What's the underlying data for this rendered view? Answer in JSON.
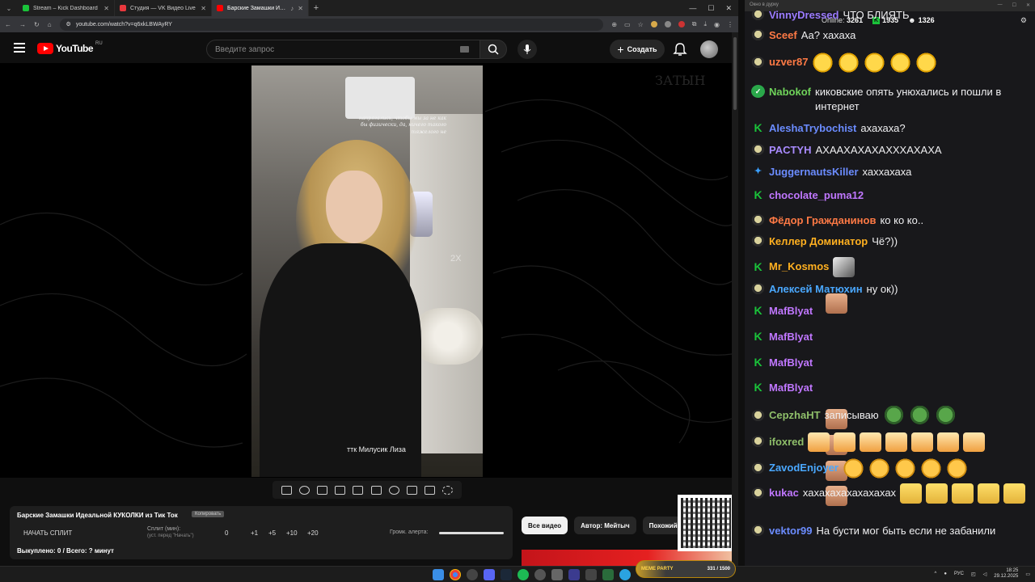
{
  "browser": {
    "tabs": [
      {
        "title": "Stream – Kick Dashboard",
        "color": "#1ac33a"
      },
      {
        "title": "Студия — VK Видео Live",
        "color": "#e8383d"
      },
      {
        "title": "Барские Замашки Идеальной",
        "color": "#ff0000"
      }
    ],
    "url": "youtube.com/watch?v=q6xkLBWAyRY"
  },
  "youtube": {
    "logo_text": "YouTube",
    "region": "RU",
    "search_placeholder": "Введите запрос",
    "create_label": "Создать"
  },
  "video": {
    "caption_top": "напрягались, чтобы мы за не как бы физически, да, ничего такого тяжелого не",
    "caption_bottom": "ттк Милусик Лиза",
    "speed_indicator": "2X",
    "watermark": "ЗАТЫН"
  },
  "extension": {
    "title": "Барские Замашки Идеальной КУКОЛКИ из Тик Ток",
    "copy_label": "Копировать",
    "start_split": "НАЧАТЬ СПЛИТ",
    "split_label": "Сплит (мин):",
    "split_hint": "(уст. перед \"Начать\")",
    "split_value": "0",
    "increments": [
      "+1",
      "+5",
      "+10",
      "+20"
    ],
    "alert_volume_label": "Громк. алерта:",
    "alert_volume": 1.0,
    "stats": "Выкуплено: 0 / Всего: ? минут"
  },
  "chips": [
    "Все видео",
    "Автор: Мейтыч",
    "Похожий"
  ],
  "chat": {
    "window_title": "Окно в дурку",
    "online_label": "Online:",
    "online_count": "3261",
    "kick_count": "1935",
    "other_count": "1326",
    "messages": [
      {
        "badge": "pepe",
        "user": "VinnyDressed",
        "color": "#9b7bff",
        "text": "ЧТО БЛИЯТЬ",
        "emotes": []
      },
      {
        "badge": "pepe",
        "user": "Sceef",
        "color": "#ff7a45",
        "text": "Аа? хахаха",
        "emotes": []
      },
      {
        "badge": "pepe",
        "user": "uzver87",
        "color": "#ff7a45",
        "text": "",
        "emotes": [
          "laugh",
          "laugh",
          "laugh",
          "laugh",
          "laugh"
        ]
      },
      {
        "badge": "verified",
        "user": "Nabokof",
        "color": "#6fd35a",
        "text": "киковские опять унюхались и пошли в интернет",
        "emotes": []
      },
      {
        "badge": "k",
        "user": "AleshaTrybochist",
        "color": "#6b8cff",
        "text": "ахахаха?",
        "emotes": []
      },
      {
        "badge": "pepe",
        "user": "PACTYH",
        "color": "#a98bff",
        "text": "АХААХАХАХАХХХАХАХА",
        "emotes": []
      },
      {
        "badge": "sword",
        "user": "JuggernautsKiller",
        "color": "#6b8cff",
        "text": "хаххахаха",
        "emotes": []
      },
      {
        "badge": "k",
        "user": "chocolate_puma12",
        "color": "#c077ff",
        "text": "",
        "emotes": [
          "face"
        ]
      },
      {
        "badge": "pepe",
        "user": "Фёдор Гражданинов",
        "color": "#ff7a45",
        "text": "ко ко ко..",
        "emotes": []
      },
      {
        "badge": "pepe",
        "user": "Келлер Доминатор",
        "color": "#ffb020",
        "text": "Чё?))",
        "emotes": []
      },
      {
        "badge": "k",
        "user": "Mr_Kosmos",
        "color": "#ffb020",
        "text": "",
        "emotes": [
          "cosmos"
        ]
      },
      {
        "badge": "pepe",
        "user": "Алексей Матюхин",
        "color": "#4aa8ff",
        "text": "ну ок))",
        "emotes": []
      },
      {
        "badge": "k",
        "user": "MafBlyat",
        "color": "#c077ff",
        "text": "",
        "emotes": [
          "face"
        ]
      },
      {
        "badge": "k",
        "user": "MafBlyat",
        "color": "#c077ff",
        "text": "",
        "emotes": [
          "face"
        ]
      },
      {
        "badge": "k",
        "user": "MafBlyat",
        "color": "#c077ff",
        "text": "",
        "emotes": [
          "face"
        ]
      },
      {
        "badge": "k",
        "user": "MafBlyat",
        "color": "#c077ff",
        "text": "",
        "emotes": [
          "face"
        ]
      },
      {
        "badge": "pepe",
        "user": "CepzhaHT",
        "color": "#8fbf6a",
        "text": "записываю",
        "emotes": [
          "pepe",
          "pepe",
          "pepe"
        ]
      },
      {
        "badge": "pepe",
        "user": "ifoxred",
        "color": "#8fbf6a",
        "text": "",
        "emotes": [
          "glow",
          "glow",
          "glow",
          "glow",
          "glow",
          "glow",
          "glow"
        ]
      },
      {
        "badge": "pepe",
        "user": "ZavodEnjoyer",
        "color": "#4aa8ff",
        "text": "",
        "emotes": [
          "cry",
          "cry",
          "cry",
          "cry",
          "cry"
        ]
      },
      {
        "badge": "pepe",
        "user": "kukac",
        "color": "#c077ff",
        "text": "хахахахахахахахах",
        "emotes": [
          "cat",
          "cat",
          "cat",
          "cat",
          "cat"
        ]
      },
      {
        "badge": "pepe",
        "user": "vektor99",
        "color": "#6b8cff",
        "text": "На бусти мог быть если не забанили",
        "emotes": []
      }
    ]
  },
  "taskbar": {
    "meme_party": "MEME PARTY",
    "meme_count": "331 / 1500",
    "lang": "РУС",
    "time": "18:25",
    "date": "29.12.2025"
  }
}
